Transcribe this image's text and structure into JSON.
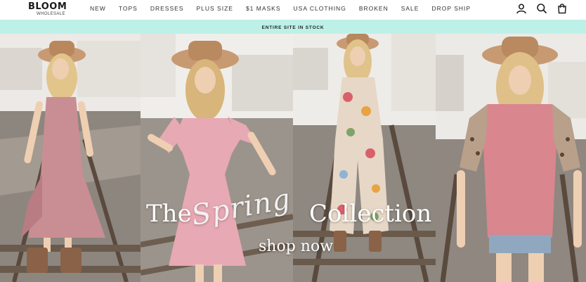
{
  "brand": {
    "name": "BLOOM",
    "tagline": "WHOLESALE"
  },
  "nav": [
    {
      "label": "NEW"
    },
    {
      "label": "TOPS"
    },
    {
      "label": "DRESSES"
    },
    {
      "label": "PLUS SIZE"
    },
    {
      "label": "$1 MASKS"
    },
    {
      "label": "USA CLOTHING"
    },
    {
      "label": "BROKEN"
    },
    {
      "label": "SALE"
    },
    {
      "label": "DROP SHIP"
    }
  ],
  "header_icons": [
    "account-icon",
    "search-icon",
    "cart-icon"
  ],
  "announcement": {
    "text": "ENTIRE SITE IN STOCK",
    "background": "#bdf1e8"
  },
  "hero": {
    "headline_the": "The",
    "headline_spring": "Spring",
    "headline_collection": "Collection",
    "cta": "shop now"
  },
  "colors": {
    "dress_mauve": "#c98e93",
    "dress_pink": "#e7a9b4",
    "top_pink": "#d9868f",
    "hat_tan": "#c89a72",
    "mint_bar": "#bdf1e8"
  }
}
